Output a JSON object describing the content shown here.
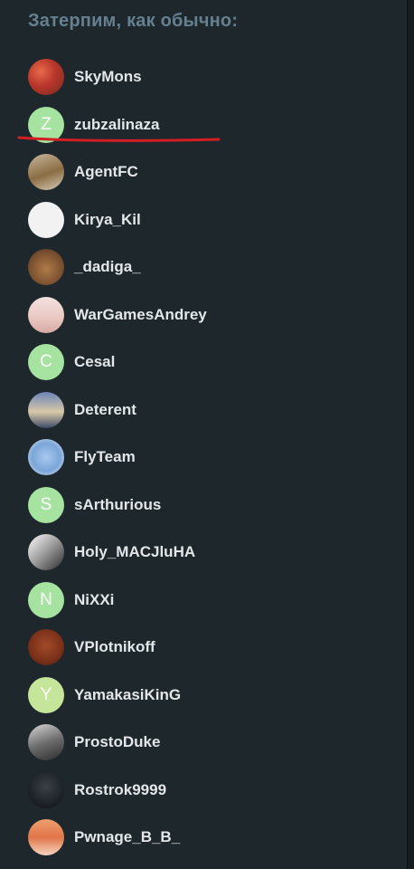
{
  "heading": "Затерпим, как обычно:",
  "colors": {
    "panel_bg": "#1e272b",
    "heading": "#66808f",
    "username": "#e3e7e9",
    "letter_avatar_bg": "#a6e3a0",
    "annotation_underline": "#d21e24"
  },
  "users": [
    {
      "name": "SkyMons",
      "avatar": "image",
      "avatar_icon": "red-pattern-avatar",
      "avatar_bg": "radial-gradient(circle at 35% 35%, #e86a4a 0%, #b8362a 45%, #7a2a22 100%)"
    },
    {
      "name": "zubzalinaza",
      "avatar": "letter",
      "letter": "Z",
      "avatar_bg": "#a6e3a0",
      "highlighted": true
    },
    {
      "name": "AgentFC",
      "avatar": "image",
      "avatar_icon": "lion-avatar",
      "avatar_bg": "linear-gradient(160deg, #c9b79c 0%, #8a6d44 55%, #d8cdb8 100%)"
    },
    {
      "name": "Kirya_Kil",
      "avatar": "image",
      "avatar_icon": "meme-face-avatar",
      "avatar_bg": "#f2f2f2"
    },
    {
      "name": "_dadiga_",
      "avatar": "image",
      "avatar_icon": "cat-avatar",
      "avatar_bg": "radial-gradient(circle at 50% 55%, #b07a48 0%, #7a5030 60%, #4a3220 100%)"
    },
    {
      "name": "WarGamesAndrey",
      "avatar": "image",
      "avatar_icon": "anime-girl-avatar",
      "avatar_bg": "linear-gradient(180deg, #f3e2e0 0%, #e9c6c0 60%, #d7a9a4 100%)"
    },
    {
      "name": "Cesal",
      "avatar": "letter",
      "letter": "C",
      "avatar_bg": "#a6e3a0"
    },
    {
      "name": "Deterent",
      "avatar": "image",
      "avatar_icon": "anime-character-avatar",
      "avatar_bg": "linear-gradient(180deg, #6c84b8 0%, #d8c9a8 55%, #3e4a66 100%)"
    },
    {
      "name": "FlyTeam",
      "avatar": "image",
      "avatar_icon": "blue-creature-avatar",
      "avatar_bg": "radial-gradient(circle at 50% 50%, #a8c8ee 0%, #7ba6d8 55%, #e8eef6 100%)"
    },
    {
      "name": "sArthurious",
      "avatar": "letter",
      "letter": "S",
      "avatar_bg": "#a6e3a0"
    },
    {
      "name": "Holy_MACJluHA",
      "avatar": "image",
      "avatar_icon": "bw-photo-avatar",
      "avatar_bg": "linear-gradient(135deg, #ffffff 0%, #9a9a9a 50%, #2a2a2a 100%)"
    },
    {
      "name": "NiXXi",
      "avatar": "letter",
      "letter": "N",
      "avatar_bg": "#a6e3a0"
    },
    {
      "name": "VPlotnikoff",
      "avatar": "image",
      "avatar_icon": "sad-face-avatar",
      "avatar_bg": "radial-gradient(circle at 50% 45%, #a24a2a 0%, #7a3018 60%, #3a1a10 100%)"
    },
    {
      "name": "YamakasiKinG",
      "avatar": "letter",
      "letter": "Y",
      "avatar_bg": "#c5e69a"
    },
    {
      "name": "ProstoDuke",
      "avatar": "image",
      "avatar_icon": "grey-photo-avatar",
      "avatar_bg": "linear-gradient(160deg, #d8d8d8 0%, #6e6e6e 50%, #2c2c2c 100%)"
    },
    {
      "name": "Rostrok9999",
      "avatar": "image",
      "avatar_icon": "dark-figure-avatar",
      "avatar_bg": "radial-gradient(circle at 50% 40%, #3a4048 0%, #1a1e24 70%, #0e1014 100%)"
    },
    {
      "name": "Pwnage_B_B_",
      "avatar": "image",
      "avatar_icon": "anime-redhead-avatar",
      "avatar_bg": "linear-gradient(180deg, #f0a070 0%, #e07448 50%, #f6d6c0 100%)"
    }
  ]
}
